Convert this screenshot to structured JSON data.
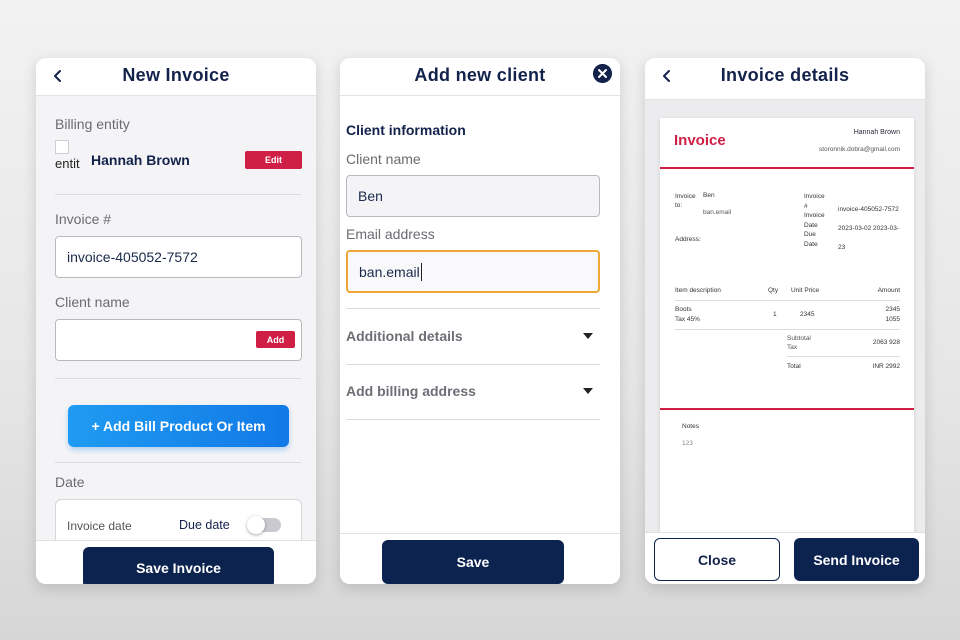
{
  "screen1": {
    "title": "New Invoice",
    "billing_label": "Billing entity",
    "entity_img_alt": "entit",
    "entity_name": "Hannah Brown",
    "edit_label": "Edit",
    "invoice_no_label": "Invoice #",
    "invoice_no_value": "invoice-405052-7572",
    "client_label": "Client name",
    "client_value": "",
    "add_label": "Add",
    "add_item_label": "+ Add Bill Product Or Item",
    "date_label": "Date",
    "invoice_date_label": "Invoice date",
    "due_date_label": "Due date",
    "due_date_toggle": false,
    "save_label": "Save Invoice"
  },
  "screen2": {
    "title": "Add new client",
    "section_title": "Client information",
    "client_name_label": "Client name",
    "client_name_value": "Ben",
    "email_label": "Email address",
    "email_value": "ban.email",
    "additional_label": "Additional details",
    "billing_label": "Add billing address",
    "save_label": "Save"
  },
  "screen3": {
    "title": "Invoice details",
    "doc": {
      "heading": "Invoice",
      "from_name": "Hannah Brown",
      "from_email": "storonnik.dobra@gmail.com",
      "invoice_to_label": "Invoice to:",
      "to_name": "Ben",
      "to_email": "ban.email",
      "address_label": "Address:",
      "meta_labels": "Invoice # Invoice Date Due Date",
      "meta_values": "invoice-405052-7572 2023-03-02 2023-03-23",
      "col_desc": "Item description",
      "col_qty": "Qty",
      "col_price": "Unit Price",
      "col_amount": "Amount",
      "item_name": "Boots",
      "item_tax": "Tax 45%",
      "item_qty": "1",
      "item_price": "2345",
      "item_amount": "2345",
      "item_tax_amount": "1055",
      "subtotal_label": "Subtotal",
      "tax_label": "Tax",
      "subtotal_value": "2063 928",
      "total_label": "Total",
      "total_value": "INR 2992",
      "notes_label": "Notes",
      "notes_value": "123"
    },
    "close_label": "Close",
    "send_label": "Send Invoice"
  },
  "colors": {
    "navy": "#0d234f",
    "accent_red": "#cf1f45",
    "blue_button": "#1a8ef0",
    "focus_orange": "#f0a834"
  }
}
